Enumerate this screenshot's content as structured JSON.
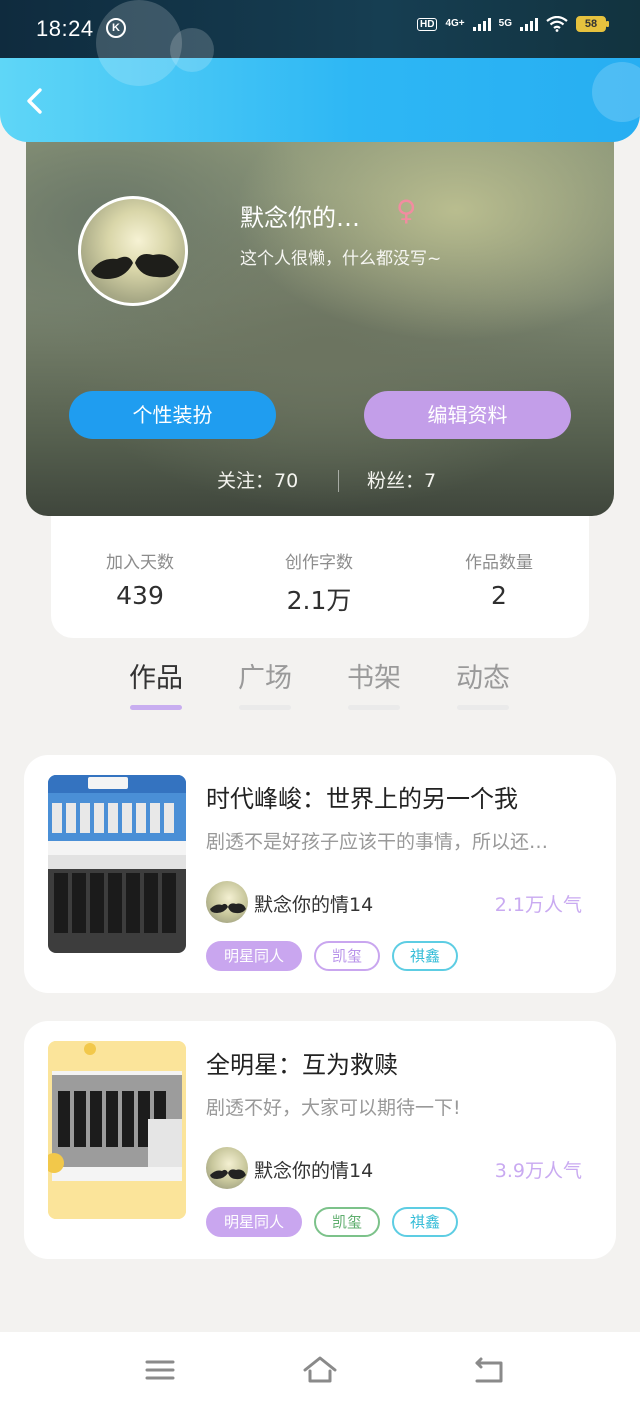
{
  "status_bar": {
    "time": "18:24",
    "k_badge": "K",
    "hd_label": "HD",
    "net1": "4G+",
    "net2": "5G",
    "battery": "58"
  },
  "header": {
    "back_icon": "chevron-left-icon"
  },
  "profile": {
    "username": "默念你的…",
    "gender_symbol": "♀",
    "bio": "这个人很懒，什么都没写~",
    "btn_style": "个性装扮",
    "btn_edit": "编辑资料",
    "following": "关注：70",
    "followers": "粉丝：7",
    "colors": {
      "style_button": "#1f9df0",
      "edit_button": "#c39ee9",
      "gender": "#f28ca0"
    }
  },
  "stats": [
    {
      "label": "加入天数",
      "value": "439"
    },
    {
      "label": "创作字数",
      "value": "2.1万"
    },
    {
      "label": "作品数量",
      "value": "2"
    }
  ],
  "tabs": [
    {
      "label": "作品",
      "active": true
    },
    {
      "label": "广场",
      "active": false
    },
    {
      "label": "书架",
      "active": false
    },
    {
      "label": "动态",
      "active": false
    }
  ],
  "works": [
    {
      "title": "时代峰峻：世界上的另一个我",
      "desc": "剧透不是好孩子应该干的事情，所以还…",
      "author": "默念你的情14",
      "popularity": "2.1万人气",
      "tags": [
        "明星同人",
        "凯玺",
        "祺鑫"
      ]
    },
    {
      "title": "全明星：互为救赎",
      "desc": "剧透不好，大家可以期待一下!",
      "author": "默念你的情14",
      "popularity": "3.9万人气",
      "tags": [
        "明星同人",
        "凯玺",
        "祺鑫"
      ]
    }
  ],
  "bottom_nav": {
    "menu_icon": "menu-icon",
    "home_icon": "home-icon",
    "back_icon": "back-icon"
  }
}
